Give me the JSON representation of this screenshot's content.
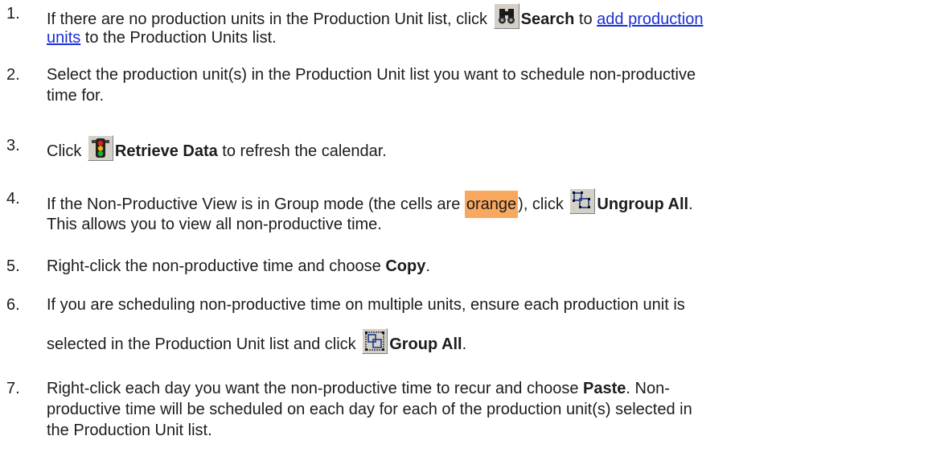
{
  "steps": [
    {
      "number": "1.",
      "pre": "If there are no production units in the Production Unit list, click ",
      "icon": "binoculars-icon",
      "bold": "Search",
      "mid": " to ",
      "link_a": "add production",
      "link_b": "units",
      "post": " to the Production Units list."
    },
    {
      "number": "2.",
      "line1": "Select the production unit(s) in the Production Unit list you want to schedule non-productive",
      "line2": "time for."
    },
    {
      "number": "3.",
      "pre": "Click ",
      "icon": "traffic-light-icon",
      "bold": "Retrieve Data",
      "post": " to refresh the calendar."
    },
    {
      "number": "4.",
      "pre": "If the Non-Productive View is in Group mode (the cells are ",
      "highlight": "orange",
      "mid": "), click ",
      "icon": "ungroup-icon",
      "bold": "Ungroup All",
      "post": ".",
      "line2": "This allows you to view all non-productive time.",
      "highlight_color": "#f9a860"
    },
    {
      "number": "5.",
      "pre": "Right-click the non-productive time and choose ",
      "bold": "Copy",
      "post": "."
    },
    {
      "number": "6.",
      "line1": "If you are scheduling non-productive time on multiple units, ensure each production unit is",
      "pre2": "selected in the Production Unit list and click ",
      "icon": "group-icon",
      "bold": "Group All",
      "post": "."
    },
    {
      "number": "7.",
      "pre": "Right-click each day you want the non-productive time to recur and choose ",
      "bold": "Paste",
      "post": ". Non-",
      "line2": "productive time will be scheduled on each day for each of the production unit(s) selected in",
      "line3": "the Production Unit list."
    }
  ],
  "colors": {
    "link": "#1a2fd6",
    "highlight_orange": "#f9a860",
    "text": "#1c1c1c"
  }
}
